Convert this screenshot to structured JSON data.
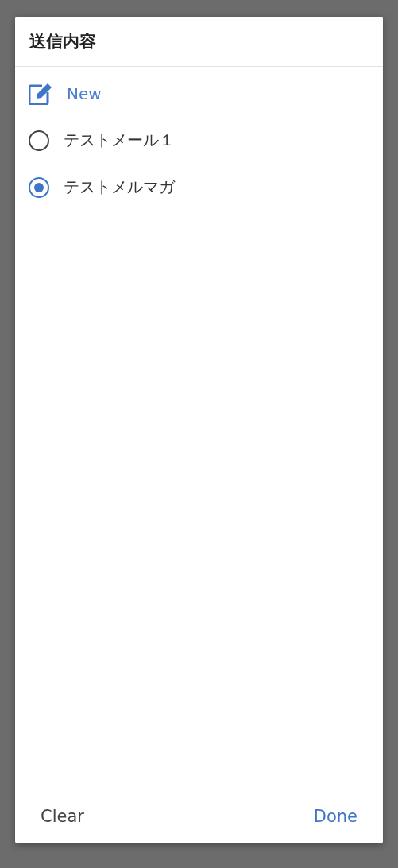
{
  "dialog": {
    "title": "送信内容",
    "new_item": {
      "label": "New"
    },
    "options": [
      {
        "label": "テストメール１",
        "selected": false
      },
      {
        "label": "テストメルマガ",
        "selected": true
      }
    ],
    "footer": {
      "clear": "Clear",
      "done": "Done"
    }
  }
}
